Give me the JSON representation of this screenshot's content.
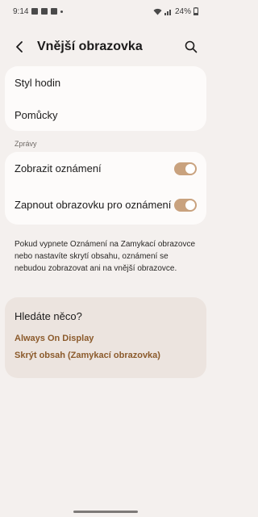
{
  "status_bar": {
    "time": "9:14",
    "battery": "24%"
  },
  "header": {
    "title": "Vnější obrazovka"
  },
  "group1": {
    "items": [
      {
        "label": "Styl hodin"
      },
      {
        "label": "Pomůcky"
      }
    ]
  },
  "notifications": {
    "section_label": "Zprávy",
    "items": [
      {
        "label": "Zobrazit oznámení",
        "enabled": true
      },
      {
        "label": "Zapnout obrazovku pro oznámení",
        "enabled": true
      }
    ]
  },
  "info_text": "Pokud vypnete Oznámení na Zamykací obrazovce nebo nastavíte skrytí obsahu, oznámení se nebudou zobrazovat ani na vnější obrazovce.",
  "suggestions": {
    "title": "Hledáte něco?",
    "links": [
      {
        "label": "Always On Display"
      },
      {
        "label": "Skrýt obsah (Zamykací obrazovka)"
      }
    ]
  },
  "colors": {
    "accent": "#8b5a2b",
    "toggle_on": "#c9a27e",
    "background": "#f4f0ee",
    "card": "#fdfbfa"
  }
}
